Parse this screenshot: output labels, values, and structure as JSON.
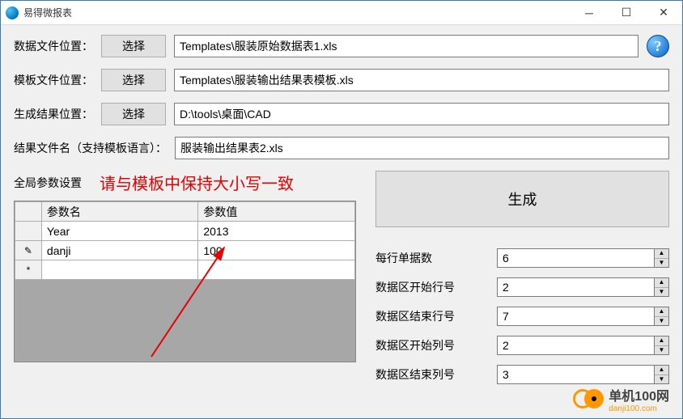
{
  "title": "易得微报表",
  "labels": {
    "data_file": "数据文件位置：",
    "template_file": "模板文件位置：",
    "result_loc": "生成结果位置：",
    "result_name": "结果文件名（支持模板语言）：",
    "choose": "选择"
  },
  "values": {
    "data_file": "Templates\\服装原始数据表1.xls",
    "template_file": "Templates\\服装输出结果表模板.xls",
    "result_loc": "D:\\tools\\桌面\\CAD",
    "result_name": "服装输出结果表2.xls"
  },
  "global_params": {
    "title": "全局参数设置",
    "hint": "请与模板中保持大小写一致",
    "columns": {
      "name": "参数名",
      "value": "参数值"
    },
    "rows": [
      {
        "marker": "",
        "name": "Year",
        "value": "2013"
      },
      {
        "marker": "✎",
        "name": "danji",
        "value": "100"
      },
      {
        "marker": "*",
        "name": "",
        "value": ""
      }
    ]
  },
  "generate": "生成",
  "numeric": [
    {
      "label": "每行单据数",
      "value": "6"
    },
    {
      "label": "数据区开始行号",
      "value": "2"
    },
    {
      "label": "数据区结束行号",
      "value": "7"
    },
    {
      "label": "数据区开始列号",
      "value": "2"
    },
    {
      "label": "数据区结束列号",
      "value": "3"
    }
  ],
  "help": "?",
  "watermark": {
    "name": "单机100网",
    "url": "danji100.com"
  }
}
